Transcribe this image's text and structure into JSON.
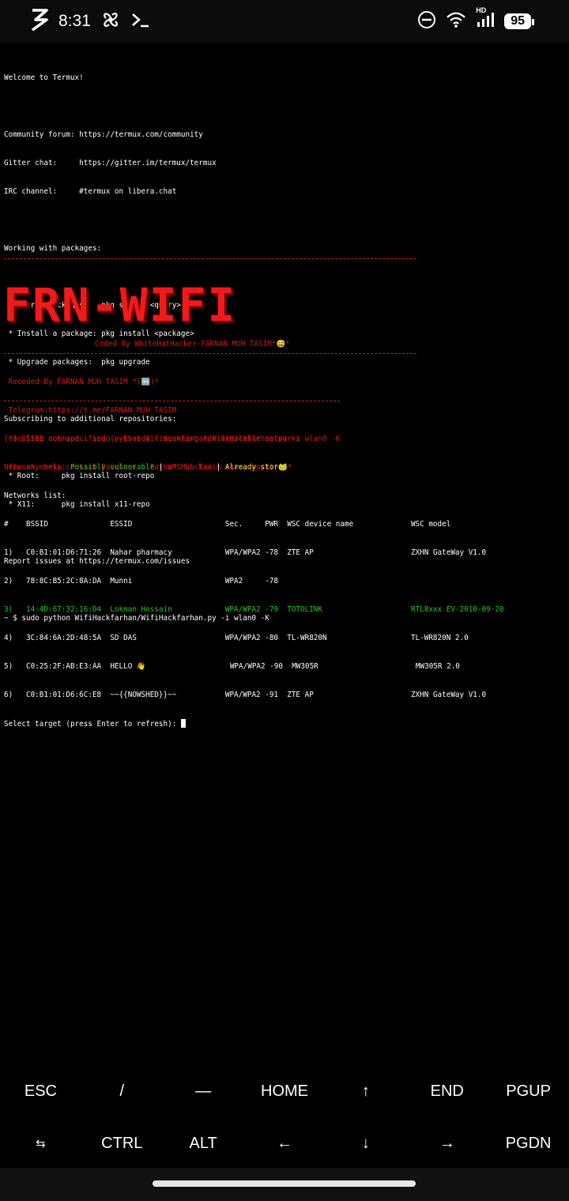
{
  "status_bar": {
    "time": "8:31",
    "battery": "95",
    "network": "HD"
  },
  "terminal": {
    "welcome": "Welcome to Termux!",
    "community": "Community forum: https://termux.com/community",
    "gitter": "Gitter chat:     https://gitter.im/termux/termux",
    "irc": "IRC channel:     #termux on libera.chat",
    "working": "Working with packages:",
    "pkg_search": " * Search packages:   pkg search <query>",
    "pkg_install": " * Install a package: pkg install <package>",
    "pkg_upgrade": " * Upgrade packages:  pkg upgrade",
    "subscribing": "Subscribing to additional repositories:",
    "root": " * Root:     pkg install root-repo",
    "x11": " * X11:      pkg install x11-repo",
    "report": "Report issues at https://termux.com/issues",
    "prompt": "~ $ sudo python WifiHackfarhan/WifiHackfarhan.py -i wlan0 -K",
    "banner": "FRN-WIFI",
    "coded_by": "Coded By WhiteHatHacker-FARNAN MUH TASIM*😅*",
    "recoded": " Recoded By FARNAN MUH TASIM *(🆒)*",
    "telegram": " Telegram:https://t.me/FARNAN_MUH_TASIM",
    "one_line": " one line command : sudo python WifiHackfarhan/WifiHackfarhan.py -i wlan0 -K",
    "help": " for any help contact Facebook : Farhan Muh Tasim (nasa hack)*🐸*",
    "bssid_warn": "[*] BSSID not specified (--bssid) — scanning for available networks",
    "marks_label": "Network marks: ",
    "marks_vuln": "Possibly vulnerable",
    "marks_sep": " | ",
    "marks_locked": "WPS locked",
    "marks_stored": "Already stored",
    "networks_list": "Networks list:",
    "table_header": "#    BSSID              ESSID                     Sec.     PWR  WSC device name             WSC model",
    "rows": [
      "1)   C0:B1:01:D6:71:26  Nahar pharmacy            WPA/WPA2 -78  ZTE AP                      ZXHN GateWay V1.0",
      "2)   78:8C:B5:2C:8A:DA  Munni                     WPA2     -78",
      "3)   14:4D:67:32:16:D4  Lokman Hossain            WPA/WPA2 -79  TOTOLINK                    RTL8xxx EV-2010-09-20",
      "4)   3C:84:6A:2D:48:5A  SD DAS                    WPA/WPA2 -80  TL-WR820N                   TL-WR820N 2.0",
      "5)   C0:25:2F:AB:E3:AA  HELLO 👋                   WPA/WPA2 -90  MW305R                      MW305R 2.0",
      "6)   C0:B1:01:D6:6C:E8  ~~{{NOWSHED}}~~           WPA/WPA2 -91  ZTE AP                      ZXHN GateWay V1.0"
    ],
    "select": "Select target (press Enter to refresh): "
  },
  "extra_keys": {
    "row1": [
      "ESC",
      "/",
      "—",
      "HOME",
      "↑",
      "END",
      "PGUP"
    ],
    "row2": [
      "⇆",
      "CTRL",
      "ALT",
      "←",
      "↓",
      "→",
      "PGDN"
    ]
  }
}
